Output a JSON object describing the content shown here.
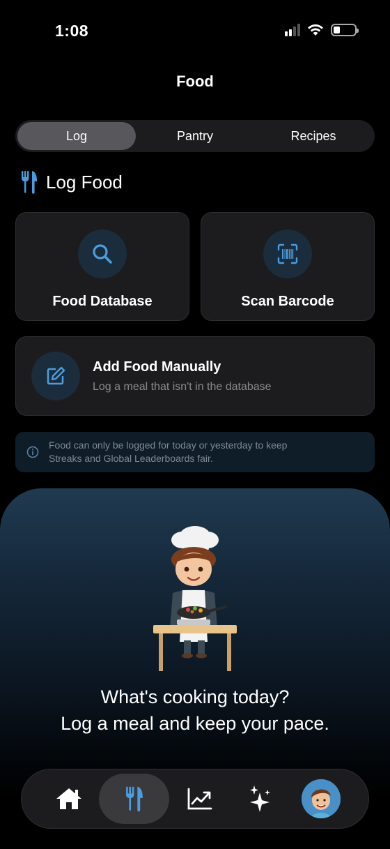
{
  "status": {
    "time": "1:08",
    "battery_level": 0.3
  },
  "nav": {
    "title": "Food"
  },
  "segments": [
    {
      "label": "Log",
      "active": true
    },
    {
      "label": "Pantry",
      "active": false
    },
    {
      "label": "Recipes",
      "active": false
    }
  ],
  "section": {
    "title": "Log Food",
    "icon": "fork-knife-icon"
  },
  "tiles": {
    "food_database": {
      "label": "Food Database",
      "icon": "search-icon"
    },
    "scan_barcode": {
      "label": "Scan Barcode",
      "icon": "barcode-scan-icon"
    }
  },
  "manual": {
    "title": "Add Food Manually",
    "subtitle": "Log a meal that isn't in the database",
    "icon": "edit-icon"
  },
  "info": {
    "line1": "Food can only be logged for today or yesterday to keep",
    "line2": "Streaks and Global Leaderboards fair."
  },
  "hero": {
    "line1": "What's cooking today?",
    "line2": "Log a meal and keep your pace."
  },
  "tabbar": [
    {
      "icon": "home-icon",
      "active": false
    },
    {
      "icon": "fork-knife-icon",
      "active": true
    },
    {
      "icon": "chart-icon",
      "active": false
    },
    {
      "icon": "sparkles-icon",
      "active": false
    },
    {
      "icon": "avatar",
      "active": false
    }
  ],
  "colors": {
    "accent": "#4a9de0",
    "background": "#000000",
    "card": "#1c1c1e"
  }
}
